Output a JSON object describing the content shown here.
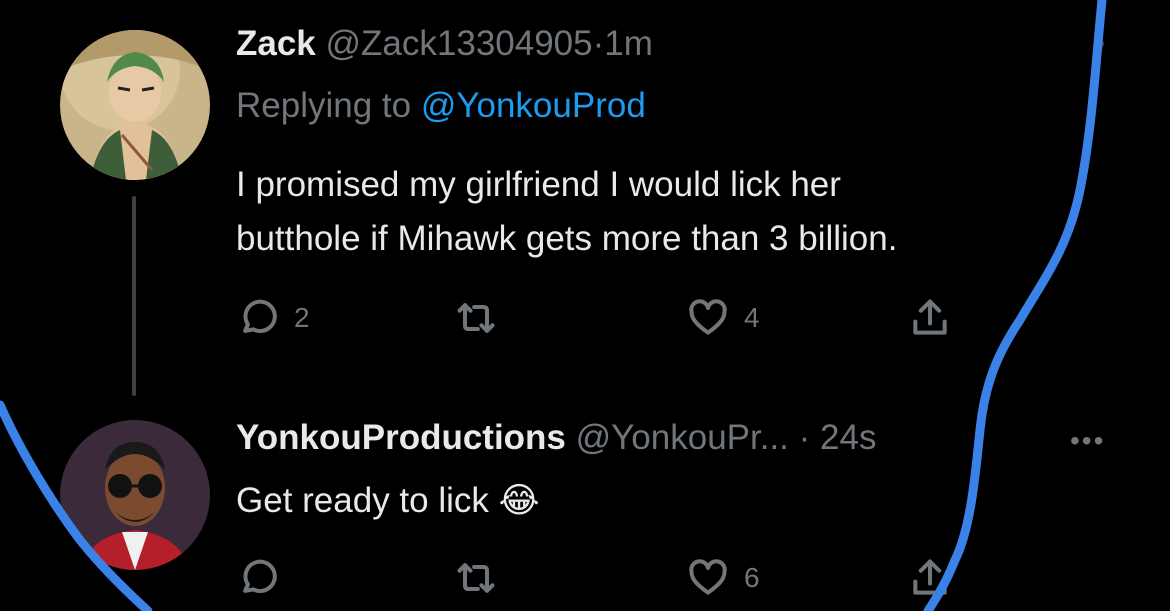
{
  "tweet1": {
    "name": "Zack",
    "handle": "@Zack13304905",
    "separator": "·",
    "time": "1m",
    "replying_prefix": "Replying to",
    "replying_to": "@YonkouProd",
    "text_line1": "I promised my girlfriend I would lick her",
    "text_line2": "butthole if Mihawk gets more than 3 billion.",
    "reply_count": "2",
    "retweet_count": "",
    "like_count": "4"
  },
  "tweet2": {
    "name": "YonkouProductions",
    "handle": "@YonkouPr...",
    "separator": "·",
    "time": "24s",
    "text": "Get ready to lick",
    "emoji": "😂",
    "reply_count": "",
    "retweet_count": "",
    "like_count": "6"
  },
  "icons": {
    "reply": "reply-icon",
    "retweet": "retweet-icon",
    "like": "heart-icon",
    "share": "share-icon",
    "more": "more-icon"
  },
  "colors": {
    "background": "#000000",
    "text": "#e7e9ea",
    "muted": "#71767b",
    "link": "#1d9bf0",
    "annotation": "#3b82e8"
  }
}
